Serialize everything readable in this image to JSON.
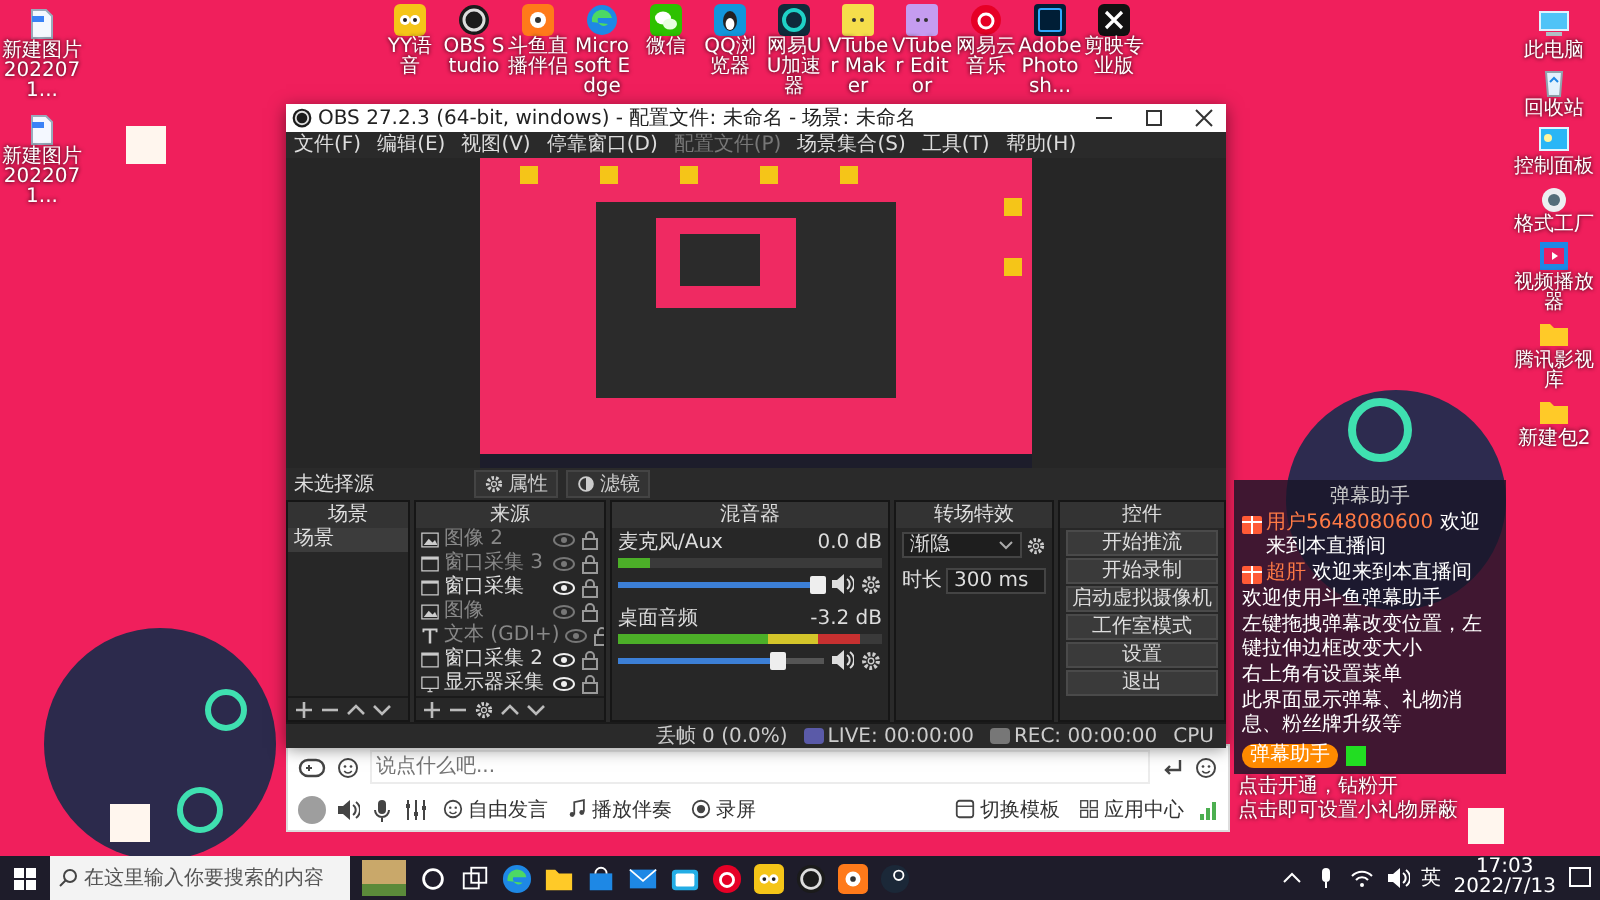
{
  "desktop": {
    "top_icons": [
      {
        "kind": "yy",
        "label": "YY语音"
      },
      {
        "kind": "obs",
        "label": "OBS Studio"
      },
      {
        "kind": "douyu",
        "label": "斗鱼直播伴侣"
      },
      {
        "kind": "edge",
        "label": "Microsoft Edge"
      },
      {
        "kind": "wechat",
        "label": "微信"
      },
      {
        "kind": "qq",
        "label": "QQ浏览器"
      },
      {
        "kind": "uu",
        "label": "网易UU加速器"
      },
      {
        "kind": "vtuber",
        "label": "VTuber Maker"
      },
      {
        "kind": "vtuber2",
        "label": "VTuber Editor"
      },
      {
        "kind": "netease",
        "label": "网易云音乐"
      },
      {
        "kind": "ps",
        "label": "Adobe Photosh..."
      },
      {
        "kind": "capcut",
        "label": "剪映专业版"
      }
    ],
    "left_icons": [
      {
        "kind": "file",
        "label": "新建图片 2022071..."
      },
      {
        "kind": "file",
        "label": "新建图片 2022071..."
      }
    ],
    "right_icons": [
      {
        "kind": "pc",
        "label": "此电脑"
      },
      {
        "kind": "bin",
        "label": "回收站"
      },
      {
        "kind": "panel",
        "label": "控制面板"
      },
      {
        "kind": "factory",
        "label": "格式工厂"
      },
      {
        "kind": "video",
        "label": "视频播放器"
      },
      {
        "kind": "folder",
        "label": "腾讯影视库"
      },
      {
        "kind": "folder",
        "label": "新建包2"
      }
    ]
  },
  "obs": {
    "title": "OBS 27.2.3 (64-bit, windows) - 配置文件: 未命名 - 场景: 未命名",
    "menu": [
      {
        "label": "文件(F)",
        "disabled": false
      },
      {
        "label": "编辑(E)",
        "disabled": false
      },
      {
        "label": "视图(V)",
        "disabled": false
      },
      {
        "label": "停靠窗口(D)",
        "disabled": false
      },
      {
        "label": "配置文件(P)",
        "disabled": true
      },
      {
        "label": "场景集合(S)",
        "disabled": false
      },
      {
        "label": "工具(T)",
        "disabled": false
      },
      {
        "label": "帮助(H)",
        "disabled": false
      }
    ],
    "toolbar": {
      "source_label": "未选择源",
      "buttons": [
        {
          "kind": "gear",
          "label": "属性"
        },
        {
          "kind": "filter",
          "label": "滤镜"
        }
      ]
    },
    "scenes": {
      "title": "场景",
      "items": [
        {
          "label": "场景",
          "selected": true
        }
      ]
    },
    "sources": {
      "title": "来源",
      "items": [
        {
          "kind": "image",
          "label": "图像 2",
          "visible": false
        },
        {
          "kind": "window",
          "label": "窗口采集 3",
          "visible": false
        },
        {
          "kind": "window",
          "label": "窗口采集",
          "visible": true
        },
        {
          "kind": "image",
          "label": "图像",
          "visible": false
        },
        {
          "kind": "text",
          "label": "文本 (GDI+)",
          "visible": false
        },
        {
          "kind": "window",
          "label": "窗口采集 2",
          "visible": true
        },
        {
          "kind": "monitor",
          "label": "显示器采集",
          "visible": true
        }
      ]
    },
    "mixer": {
      "title": "混音器",
      "channels": [
        {
          "name": "麦克风/Aux",
          "reading": "0.0 dB",
          "meter": {
            "level": 0.12
          },
          "fader": {
            "level": 0.97
          }
        },
        {
          "name": "桌面音频",
          "reading": "-3.2 dB",
          "meter": {
            "level": 0.92
          },
          "fader": {
            "level": 0.78
          }
        }
      ]
    },
    "transitions": {
      "title": "转场特效",
      "transition": "渐隐",
      "duration_label": "时长",
      "duration": "300 ms"
    },
    "controls": {
      "title": "控件",
      "buttons": [
        "开始推流",
        "开始录制",
        "启动虚拟摄像机",
        "工作室模式",
        "设置",
        "退出"
      ]
    },
    "status": [
      {
        "kind": "plain",
        "text": "丢帧 0 (0.0%)"
      },
      {
        "kind": "live",
        "text": "LIVE: 00:00:00"
      },
      {
        "kind": "rec",
        "text": "REC: 00:00:00"
      },
      {
        "kind": "plain",
        "text": "CPU"
      }
    ]
  },
  "companion": {
    "input": {
      "placeholder": "说点什么吧..."
    },
    "tools": [
      {
        "kind": "smile",
        "label": "自由发言"
      },
      {
        "kind": "music",
        "label": "播放伴奏"
      },
      {
        "kind": "record",
        "label": "录屏"
      }
    ],
    "right_tools": [
      {
        "kind": "template",
        "label": "切换模板"
      },
      {
        "kind": "apps",
        "label": "应用中心"
      }
    ]
  },
  "danmaku": {
    "title": "弹幕助手",
    "messages": [
      {
        "user": "用户5648080600",
        "text": "欢迎来到本直播间"
      },
      {
        "user": "超肝",
        "text": "欢迎来到本直播间"
      }
    ],
    "notices": [
      "欢迎使用斗鱼弹幕助手",
      "左键拖拽弹幕改变位置，左键拉伸边框改变大小",
      "右上角有设置菜单",
      "此界面显示弹幕、礼物消息、粉丝牌升级等"
    ],
    "badge": "弹幕助手"
  },
  "tips": [
    "点击开通，钻粉开",
    "点击即可设置小礼物屏蔽"
  ],
  "taskbar": {
    "search_placeholder": "在这里输入你要搜索的内容",
    "apps": [
      {
        "kind": "cortana"
      },
      {
        "kind": "taskview"
      },
      {
        "kind": "edge"
      },
      {
        "kind": "folder"
      },
      {
        "kind": "store"
      },
      {
        "kind": "mail"
      },
      {
        "kind": "bili"
      },
      {
        "kind": "netease"
      },
      {
        "kind": "yy"
      },
      {
        "kind": "obs"
      },
      {
        "kind": "douyu"
      },
      {
        "kind": "steam"
      }
    ],
    "ime": "英",
    "time": "17:03",
    "date": "2022/7/13"
  }
}
